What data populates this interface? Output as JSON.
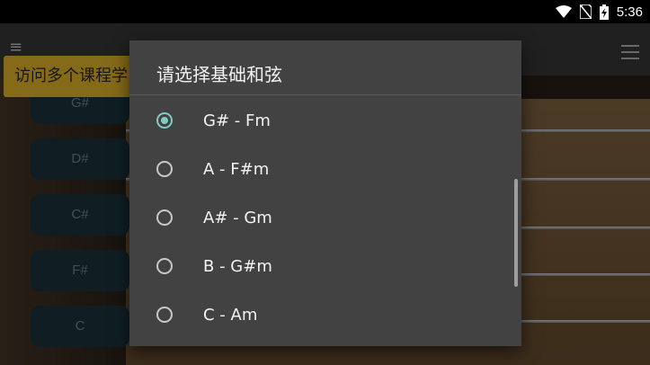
{
  "status_bar": {
    "time": "5:36",
    "icons": [
      "wifi-icon",
      "no-sim-icon",
      "battery-charging-icon"
    ]
  },
  "background": {
    "lesson_banner": "访问多个课程学",
    "chord_buttons": [
      "G#",
      "D#",
      "C#",
      "F#",
      "C"
    ]
  },
  "dialog": {
    "title": "请选择基础和弦",
    "selected_index": 0,
    "options": [
      {
        "label": "G# - Fm"
      },
      {
        "label": "A - F#m"
      },
      {
        "label": "A# - Gm"
      },
      {
        "label": "B - G#m"
      },
      {
        "label": "C - Am"
      }
    ]
  },
  "colors": {
    "dialog_bg": "#424242",
    "accent": "#80cbc4",
    "banner": "#f2c12e"
  }
}
